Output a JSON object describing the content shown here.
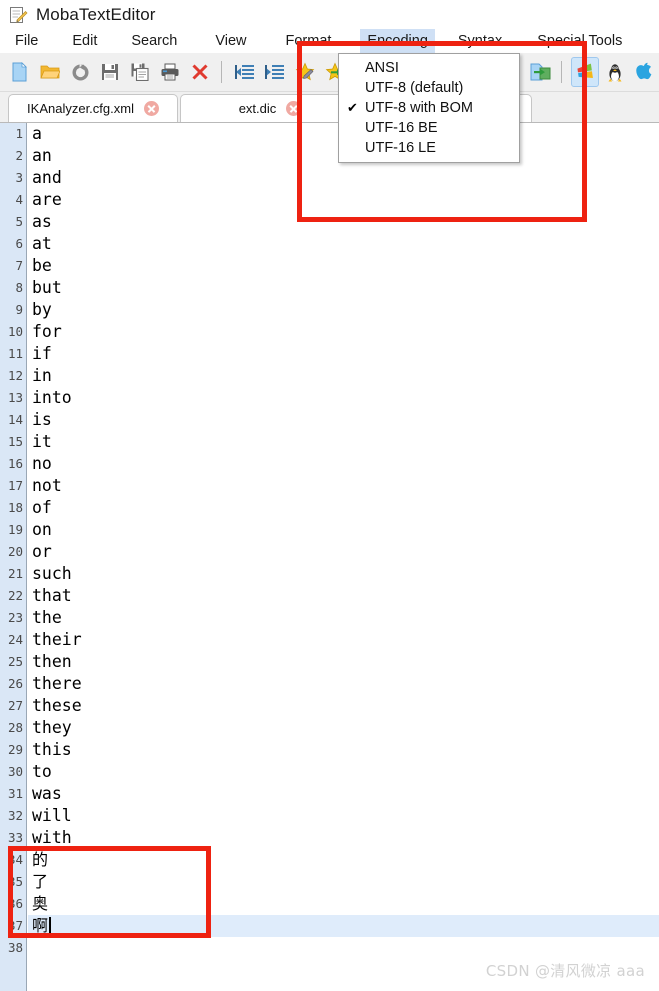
{
  "window": {
    "title": "MobaTextEditor",
    "icon": "notepad-pencil-icon"
  },
  "menubar": {
    "items": [
      {
        "label": "File",
        "name": "menu-file",
        "selected": false
      },
      {
        "label": "Edit",
        "name": "menu-edit",
        "selected": false
      },
      {
        "label": "Search",
        "name": "menu-search",
        "selected": false
      },
      {
        "label": "View",
        "name": "menu-view",
        "selected": false
      },
      {
        "label": "Format",
        "name": "menu-format",
        "selected": false
      },
      {
        "label": "Encoding",
        "name": "menu-encoding",
        "selected": true
      },
      {
        "label": "Syntax",
        "name": "menu-syntax",
        "selected": false
      },
      {
        "label": "Special Tools",
        "name": "menu-special",
        "selected": false
      }
    ]
  },
  "toolbar": {
    "buttons": [
      {
        "icon": "new-file-icon",
        "title": "New"
      },
      {
        "icon": "open-folder-icon",
        "title": "Open"
      },
      {
        "icon": "reload-icon",
        "title": "Reload"
      },
      {
        "icon": "save-icon",
        "title": "Save"
      },
      {
        "icon": "save-as-icon",
        "title": "Save As"
      },
      {
        "icon": "print-icon",
        "title": "Print"
      },
      {
        "icon": "close-x-icon",
        "title": "Close"
      },
      {
        "icon": "outdent-icon",
        "title": "Outdent"
      },
      {
        "icon": "indent-icon",
        "title": "Indent"
      },
      {
        "icon": "bookmark-star-icon",
        "title": "Toggle bookmark"
      },
      {
        "icon": "next-bookmark-icon",
        "title": "Next bookmark"
      },
      {
        "icon": "page-left-icon",
        "title": "Previous"
      },
      {
        "icon": "page-right-icon",
        "title": "Next"
      },
      {
        "icon": "windows-format-icon",
        "title": "Windows format",
        "selected": true
      },
      {
        "icon": "linux-format-icon",
        "title": "Unix format"
      },
      {
        "icon": "mac-format-icon",
        "title": "Mac format"
      }
    ]
  },
  "tabs": [
    {
      "label": "IKAnalyzer.cfg.xml",
      "active": false
    },
    {
      "label": "ext.dic",
      "active": true
    },
    {
      "label": "",
      "active": false
    }
  ],
  "encoding_menu": {
    "items": [
      {
        "label": "ANSI",
        "checked": false
      },
      {
        "label": "UTF-8 (default)",
        "checked": false
      },
      {
        "label": "UTF-8 with BOM",
        "checked": true
      },
      {
        "label": "UTF-16 BE",
        "checked": false
      },
      {
        "label": "UTF-16 LE",
        "checked": false
      }
    ],
    "check_glyph": "✔"
  },
  "editor": {
    "current_line": 37,
    "lines": [
      {
        "n": 1,
        "text": "a"
      },
      {
        "n": 2,
        "text": "an"
      },
      {
        "n": 3,
        "text": "and"
      },
      {
        "n": 4,
        "text": "are"
      },
      {
        "n": 5,
        "text": "as"
      },
      {
        "n": 6,
        "text": "at"
      },
      {
        "n": 7,
        "text": "be"
      },
      {
        "n": 8,
        "text": "but"
      },
      {
        "n": 9,
        "text": "by"
      },
      {
        "n": 10,
        "text": "for"
      },
      {
        "n": 11,
        "text": "if"
      },
      {
        "n": 12,
        "text": "in"
      },
      {
        "n": 13,
        "text": "into"
      },
      {
        "n": 14,
        "text": "is"
      },
      {
        "n": 15,
        "text": "it"
      },
      {
        "n": 16,
        "text": "no"
      },
      {
        "n": 17,
        "text": "not"
      },
      {
        "n": 18,
        "text": "of"
      },
      {
        "n": 19,
        "text": "on"
      },
      {
        "n": 20,
        "text": "or"
      },
      {
        "n": 21,
        "text": "such"
      },
      {
        "n": 22,
        "text": "that"
      },
      {
        "n": 23,
        "text": "the"
      },
      {
        "n": 24,
        "text": "their"
      },
      {
        "n": 25,
        "text": "then"
      },
      {
        "n": 26,
        "text": "there"
      },
      {
        "n": 27,
        "text": "these"
      },
      {
        "n": 28,
        "text": "they"
      },
      {
        "n": 29,
        "text": "this"
      },
      {
        "n": 30,
        "text": "to"
      },
      {
        "n": 31,
        "text": "was"
      },
      {
        "n": 32,
        "text": "will"
      },
      {
        "n": 33,
        "text": "with"
      },
      {
        "n": 34,
        "text": "的",
        "cjk": true
      },
      {
        "n": 35,
        "text": "了",
        "cjk": true
      },
      {
        "n": 36,
        "text": "奥",
        "cjk": true
      },
      {
        "n": 37,
        "text": "啊",
        "cjk": true
      },
      {
        "n": 38,
        "text": ""
      }
    ]
  },
  "annotations": [
    {
      "name": "encoding-menu-highlight",
      "color": "#ee2211"
    },
    {
      "name": "chinese-lines-highlight",
      "color": "#ee2211"
    }
  ],
  "watermark": {
    "text": "CSDN @清风微凉 aaa"
  },
  "colors": {
    "gutter_bg": "#dae7f6",
    "current_line_bg": "#dfecfb",
    "toolbar_bg": "#f0f0f0",
    "menu_selected_bg": "#cfe0f5",
    "annotation_red": "#ee2211",
    "tab_close_red": "#f0a9a2"
  }
}
